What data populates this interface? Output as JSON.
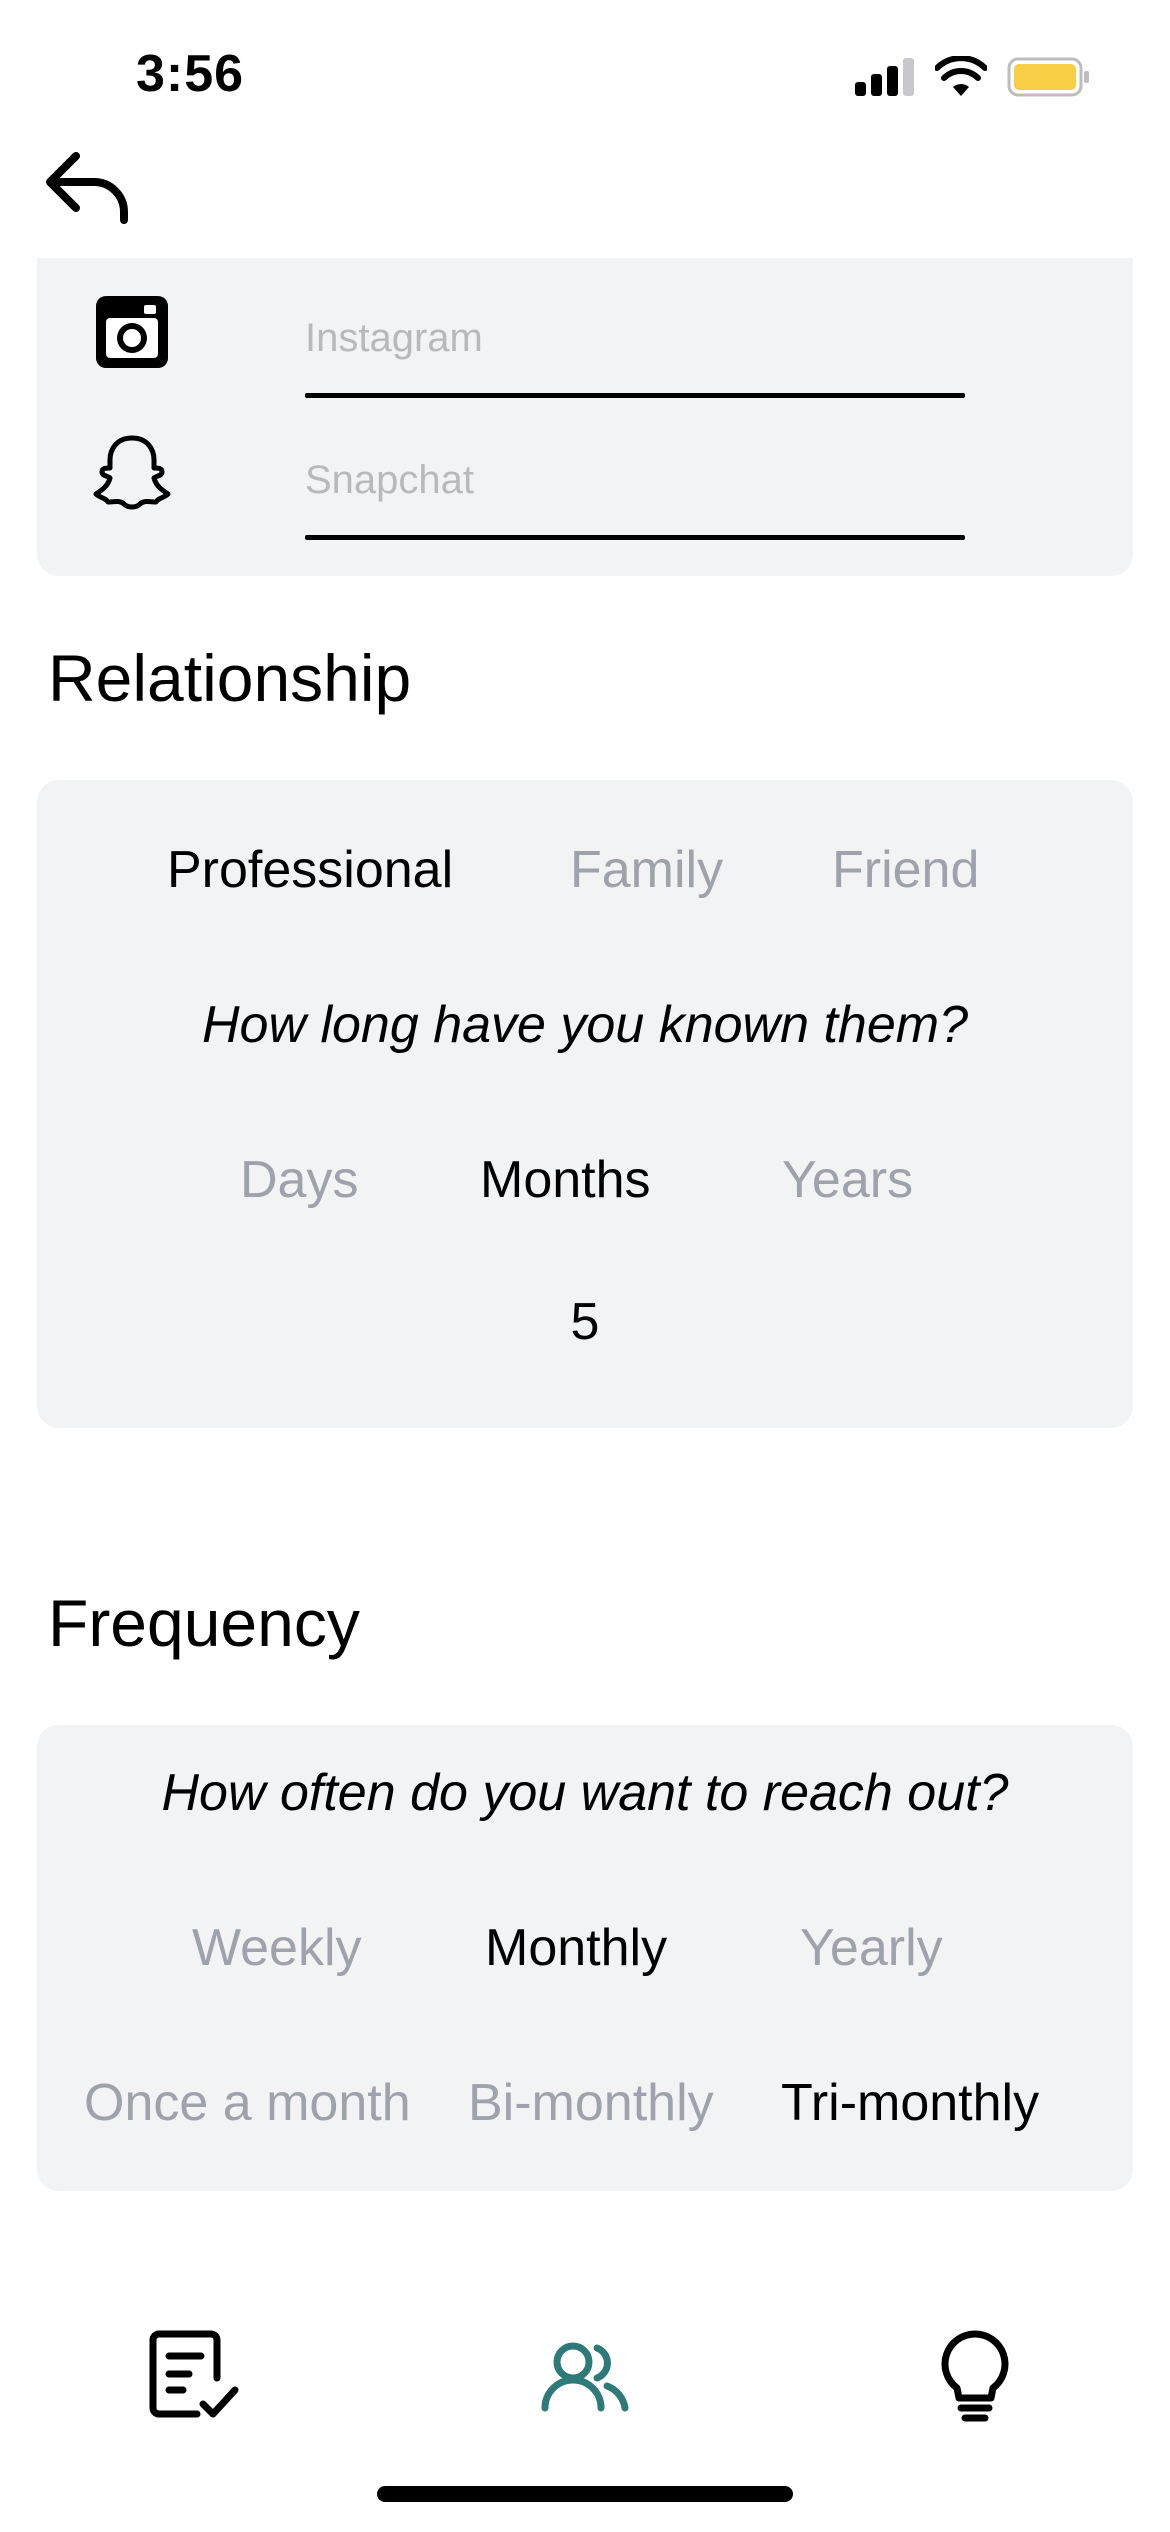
{
  "status_bar": {
    "time": "3:56",
    "icons": [
      "cellular-signal-icon",
      "wifi-icon",
      "battery-icon"
    ],
    "battery_color": "#f7ce46"
  },
  "nav": {
    "back_icon": "back-arrow-icon"
  },
  "social": {
    "instagram": {
      "icon": "instagram-icon",
      "placeholder": "Instagram",
      "value": ""
    },
    "snapchat": {
      "icon": "snapchat-icon",
      "placeholder": "Snapchat",
      "value": ""
    }
  },
  "relationship": {
    "title": "Relationship",
    "types": [
      "Professional",
      "Family",
      "Friend"
    ],
    "selected_type": "Professional",
    "question": "How long have you known them?",
    "units": [
      "Days",
      "Months",
      "Years"
    ],
    "selected_unit": "Months",
    "duration_value": "5"
  },
  "frequency": {
    "title": "Frequency",
    "question": "How often do you want to reach out?",
    "periods": [
      "Weekly",
      "Monthly",
      "Yearly"
    ],
    "selected_period": "Monthly",
    "counts": [
      "Once a month",
      "Bi-monthly",
      "Tri-monthly"
    ],
    "selected_count": "Tri-monthly"
  },
  "tab_bar": {
    "items": [
      {
        "icon": "checklist-icon",
        "active": false
      },
      {
        "icon": "contacts-icon",
        "active": true
      },
      {
        "icon": "lightbulb-icon",
        "active": false
      }
    ],
    "active_color": "#2e7a78",
    "inactive_color": "#000000"
  }
}
